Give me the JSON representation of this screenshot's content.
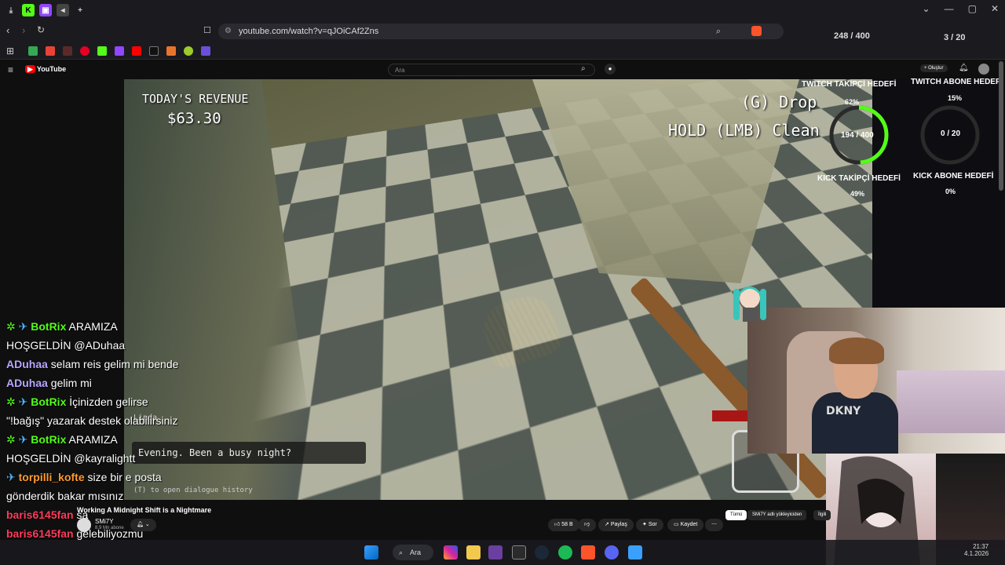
{
  "browser": {
    "url": "youtube.com/watch?v=qJOiCAf2Zns",
    "top_counter_left": "248 / 400",
    "top_counter_right": "3 / 20"
  },
  "youtube": {
    "logo": "YouTube",
    "search_placeholder": "Ara",
    "create_label": "Oluştur",
    "video_title": "Working A Midnight Shift is a Nightmare",
    "channel_name": "SMi7Y",
    "channel_subs": "8,9 Mn abone",
    "like_count": "58 B",
    "share_label": "Paylaş",
    "ask_label": "Sor",
    "save_label": "Kaydet",
    "chip_all": "Tümü",
    "chip_channel": "SMi7Y adlı yükleyiciden",
    "chip_related": "İlgili"
  },
  "game": {
    "revenue_label": "TODAY'S REVENUE",
    "revenue_value": "$63.30",
    "hint_drop": "(G) Drop",
    "hint_clean": "HOLD (LMB) Clean",
    "speaker": "Linda",
    "dialog": "Evening. Been a busy night?",
    "dialog_hint": "(T) to open dialogue history"
  },
  "stream_goals": {
    "twitch_follow_title": "TWITCH TAKİPÇİ HEDEFİ",
    "twitch_follow_pct": "62%",
    "twitch_sub_title": "TWITCH ABONE HEDEFİ",
    "twitch_sub_pct": "15%",
    "kick_follow_value": "194 / 400",
    "kick_follow_title": "KICK TAKİPÇİ HEDEFİ",
    "kick_follow_pct": "49%",
    "kick_sub_value": "0 / 20",
    "kick_sub_title": "KICK ABONE HEDEFİ",
    "kick_sub_pct": "0%"
  },
  "webcam": {
    "shirt_text": "DKNY"
  },
  "chat": [
    {
      "user": "BotRix",
      "text": "ARAMIZA",
      "cls": "bot",
      "badges": true
    },
    {
      "user": "",
      "text": "HOŞGELDİN @ADuhaa",
      "cls": "",
      "badges": false
    },
    {
      "user": "ADuhaa",
      "text": "selam reis gelim mi bende",
      "cls": "user-ad",
      "badges": false
    },
    {
      "user": "ADuhaa",
      "text": "gelim mi",
      "cls": "user-ad",
      "badges": false
    },
    {
      "user": "BotRix",
      "text": "İçinizden gelirse",
      "cls": "bot",
      "badges": true
    },
    {
      "user": "",
      "text": "\"!bağış\" yazarak destek olabilirsiniz",
      "cls": "",
      "badges": false
    },
    {
      "user": "BotRix",
      "text": "ARAMIZA",
      "cls": "bot",
      "badges": true
    },
    {
      "user": "",
      "text": "HOŞGELDİN @kayralightt",
      "cls": "",
      "badges": false
    },
    {
      "user": "torpilli_kofte",
      "text": "size bir e posta",
      "cls": "user-tk",
      "badges": false
    },
    {
      "user": "",
      "text": "gönderdik bakar mısınız",
      "cls": "",
      "badges": false
    },
    {
      "user": "baris6145fan",
      "text": "sa",
      "cls": "user-bf",
      "badges": false
    },
    {
      "user": "baris6145fan",
      "text": "gelebiliyozmu",
      "cls": "user-bf",
      "badges": false
    }
  ],
  "taskbar": {
    "search_label": "Ara",
    "time": "21:37",
    "date": "4.1.2026"
  },
  "colors": {
    "kick_green": "#53fc18",
    "twitch_purple": "#9146ff"
  }
}
